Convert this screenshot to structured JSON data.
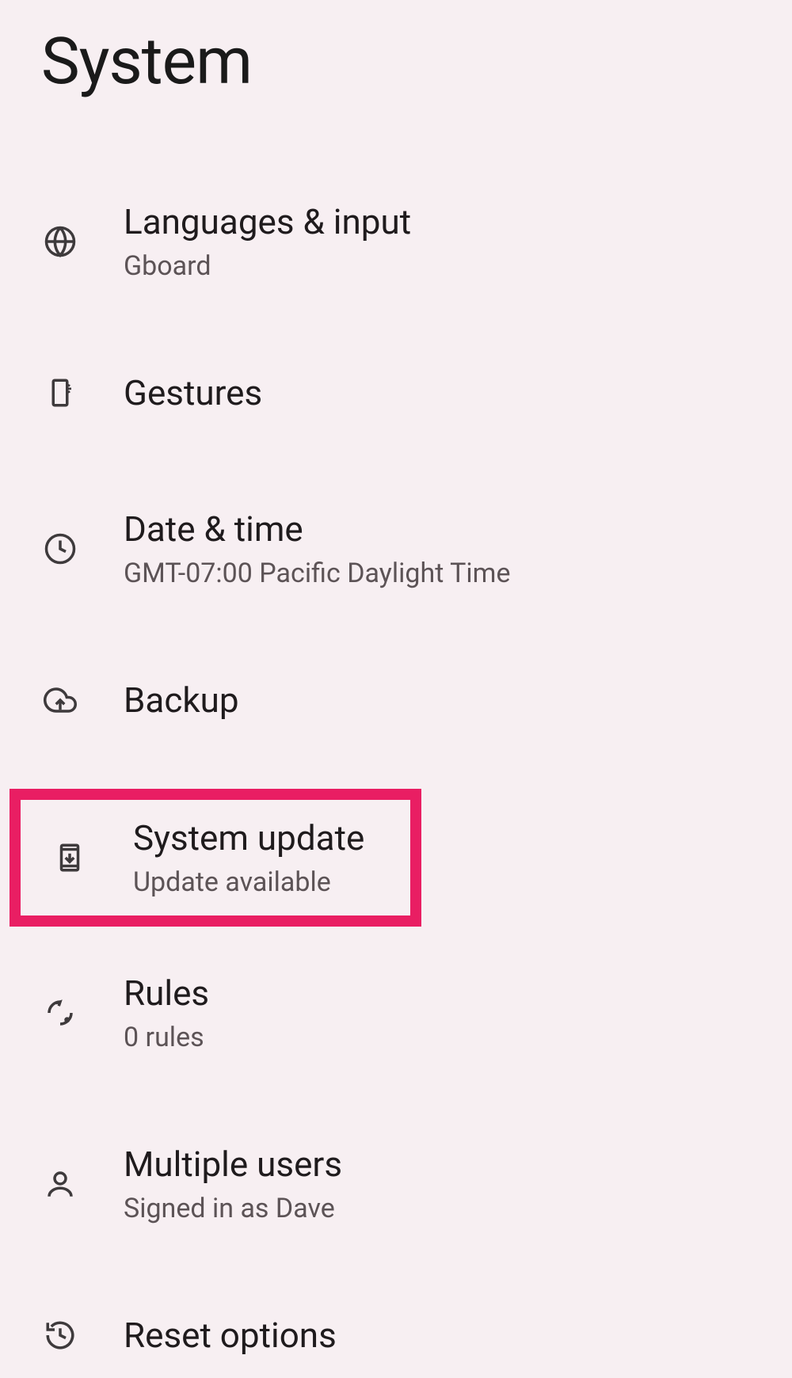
{
  "pageTitle": "System",
  "items": [
    {
      "title": "Languages & input",
      "subtitle": "Gboard"
    },
    {
      "title": "Gestures",
      "subtitle": null
    },
    {
      "title": "Date & time",
      "subtitle": "GMT-07:00 Pacific Daylight Time"
    },
    {
      "title": "Backup",
      "subtitle": null
    },
    {
      "title": "System update",
      "subtitle": "Update available"
    },
    {
      "title": "Rules",
      "subtitle": "0 rules"
    },
    {
      "title": "Multiple users",
      "subtitle": "Signed in as Dave"
    },
    {
      "title": "Reset options",
      "subtitle": null
    }
  ]
}
